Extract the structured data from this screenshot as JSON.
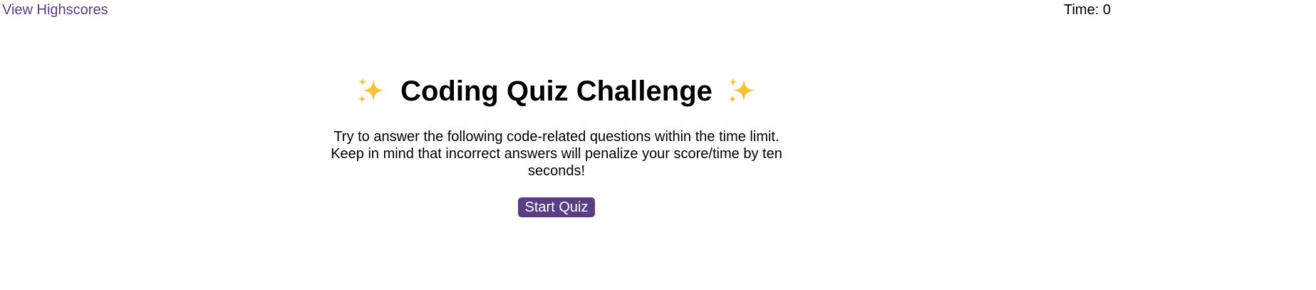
{
  "header": {
    "highscores_link": "View Highscores",
    "timer_label": "Time:",
    "timer_value": "0"
  },
  "main": {
    "title": "Coding Quiz Challenge",
    "title_icon": "sparkles-icon",
    "description": "Try to answer the following code-related questions within the time limit. Keep in mind that incorrect answers will penalize your score/time by ten seconds!",
    "start_button": "Start Quiz"
  },
  "colors": {
    "accent": "#5a3d84",
    "sparkle": "#f4c43c",
    "text": "#000000",
    "background": "#ffffff"
  }
}
